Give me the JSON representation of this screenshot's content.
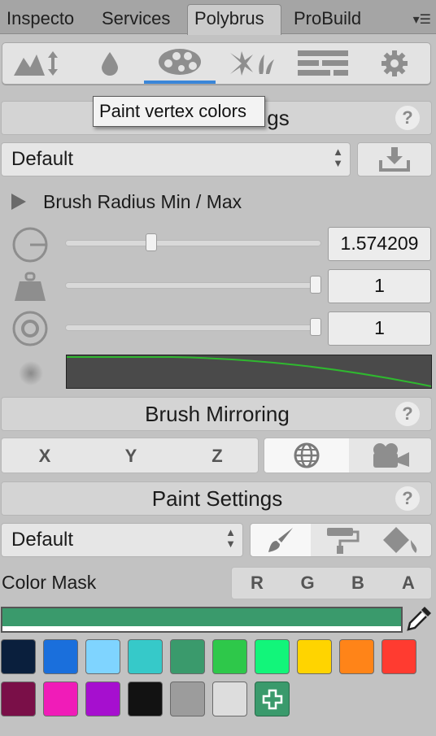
{
  "tabs": [
    {
      "label": "Inspecto",
      "active": false
    },
    {
      "label": "Services",
      "active": false
    },
    {
      "label": "Polybrus",
      "active": true
    },
    {
      "label": "ProBuild",
      "active": false
    }
  ],
  "tools": [
    {
      "icon": "sculpt-icon",
      "active": false
    },
    {
      "icon": "smooth-drop-icon",
      "active": false
    },
    {
      "icon": "palette-icon",
      "active": true
    },
    {
      "icon": "scatter-prefabs-icon",
      "active": false
    },
    {
      "icon": "texture-brick-icon",
      "active": false
    },
    {
      "icon": "gear-icon",
      "active": false
    }
  ],
  "tooltip": "Paint vertex colors",
  "brush_settings": {
    "title_visible": "gs",
    "preset": "Default",
    "radius_label": "Brush Radius Min / Max",
    "radius_value": "1.574209",
    "radius_fraction": 0.33,
    "strength_value": "1",
    "strength_fraction": 1.0,
    "falloff_value": "1",
    "falloff_fraction": 1.0
  },
  "mirroring": {
    "title": "Brush Mirroring",
    "axes": [
      "X",
      "Y",
      "Z"
    ]
  },
  "paint": {
    "title": "Paint Settings",
    "preset": "Default",
    "color_mask_label": "Color Mask",
    "channels": [
      "R",
      "G",
      "B",
      "A"
    ],
    "current_color": "#3a9a6c"
  },
  "palette_row1": [
    "#0a1f3d",
    "#1a6fdc",
    "#7fd4ff",
    "#36c9c9",
    "#3a9a6c",
    "#2ec84a",
    "#12f57a",
    "#ffd400",
    "#ff8418",
    "#ff3b30"
  ],
  "palette_row2": [
    "#7a0f48",
    "#f01cb8",
    "#a60fcf",
    "#121212",
    "#9c9c9c",
    "#dddddd"
  ],
  "colors": {
    "accent": "#3a86d9",
    "curve": "#2fb82f",
    "curve_bg": "#4a4a4a"
  }
}
